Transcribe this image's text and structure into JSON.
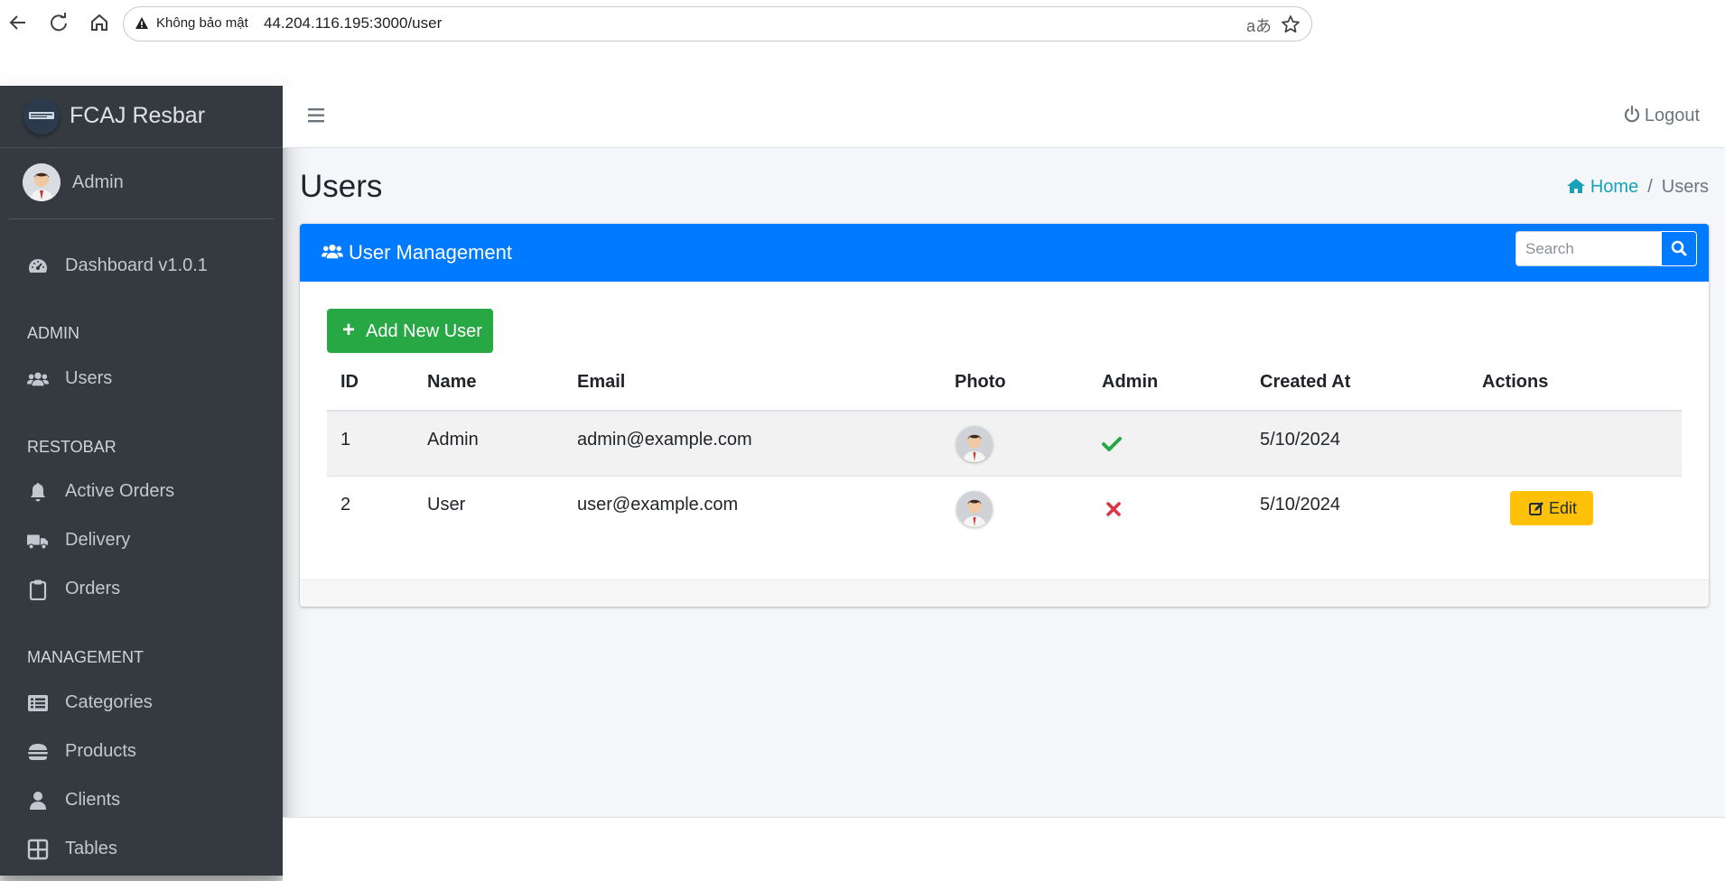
{
  "browser": {
    "security_label": "Không bảo mật",
    "url": "44.204.116.195:3000/user",
    "translate_icon": "translate-icon",
    "bookmark_icon": "star-icon"
  },
  "brand": {
    "name": "FCAJ Resbar"
  },
  "user_panel": {
    "name": "Admin"
  },
  "sidebar": {
    "dashboard": {
      "label": "Dashboard v1.0.1",
      "icon": "speedometer-icon"
    },
    "header_admin": "ADMIN",
    "users": {
      "label": "Users",
      "icon": "users-icon"
    },
    "header_restobar": "RESTOBAR",
    "active_orders": {
      "label": "Active Orders",
      "icon": "bell-icon"
    },
    "delivery": {
      "label": "Delivery",
      "icon": "truck-icon"
    },
    "orders": {
      "label": "Orders",
      "icon": "clipboard-icon"
    },
    "header_management": "MANAGEMENT",
    "categories": {
      "label": "Categories",
      "icon": "list-icon"
    },
    "products": {
      "label": "Products",
      "icon": "hamburger-food-icon"
    },
    "clients": {
      "label": "Clients",
      "icon": "user-icon"
    },
    "tables": {
      "label": "Tables",
      "icon": "grid-icon"
    }
  },
  "topbar": {
    "logout_label": "Logout"
  },
  "page": {
    "title": "Users",
    "breadcrumb": {
      "home": "Home",
      "current": "Users"
    }
  },
  "card": {
    "title": "User Management",
    "search_placeholder": "Search",
    "add_button": "Add New User",
    "columns": [
      "ID",
      "Name",
      "Email",
      "Photo",
      "Admin",
      "Created At",
      "Actions"
    ],
    "rows": [
      {
        "id": "1",
        "name": "Admin",
        "email": "admin@example.com",
        "admin": true,
        "created_at": "5/10/2024",
        "action": ""
      },
      {
        "id": "2",
        "name": "User",
        "email": "user@example.com",
        "admin": false,
        "created_at": "5/10/2024",
        "action": "Edit"
      }
    ]
  },
  "colors": {
    "sidebar_bg": "#343a40",
    "primary": "#007bff",
    "success": "#28a745",
    "warning": "#ffc107",
    "danger": "#dc3545",
    "info": "#17a2b8"
  }
}
